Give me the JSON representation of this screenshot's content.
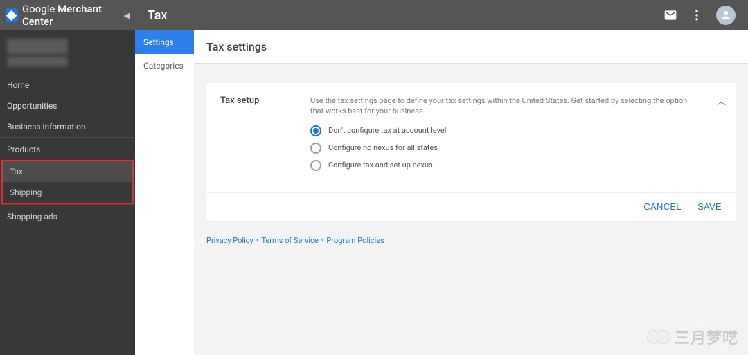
{
  "app": {
    "name_light": "Google ",
    "name_bold": "Merchant Center"
  },
  "topbar": {
    "page_title": "Tax"
  },
  "sidebar": {
    "items": [
      {
        "label": "Home"
      },
      {
        "label": "Opportunities"
      },
      {
        "label": "Business information"
      }
    ],
    "section_products": "Products",
    "tax": "Tax",
    "shipping": "Shipping",
    "shopping_ads": "Shopping ads"
  },
  "subnav": {
    "items": [
      {
        "label": "Settings",
        "active": true
      },
      {
        "label": "Categories",
        "active": false
      }
    ]
  },
  "main": {
    "header": "Tax settings",
    "card_title": "Tax setup",
    "card_desc": "Use the tax settings page to define your tax settings within the United States. Get started by selecting the option that works best for your business.",
    "options": [
      {
        "label": "Don't configure tax at account level",
        "selected": true
      },
      {
        "label": "Configure no nexus for all states",
        "selected": false
      },
      {
        "label": "Configure tax and set up nexus",
        "selected": false
      }
    ],
    "cancel": "CANCEL",
    "save": "SAVE"
  },
  "footer": {
    "privacy": "Privacy Policy",
    "terms": "Terms of Service",
    "program": "Program Policies"
  },
  "watermark": "三月梦呓"
}
